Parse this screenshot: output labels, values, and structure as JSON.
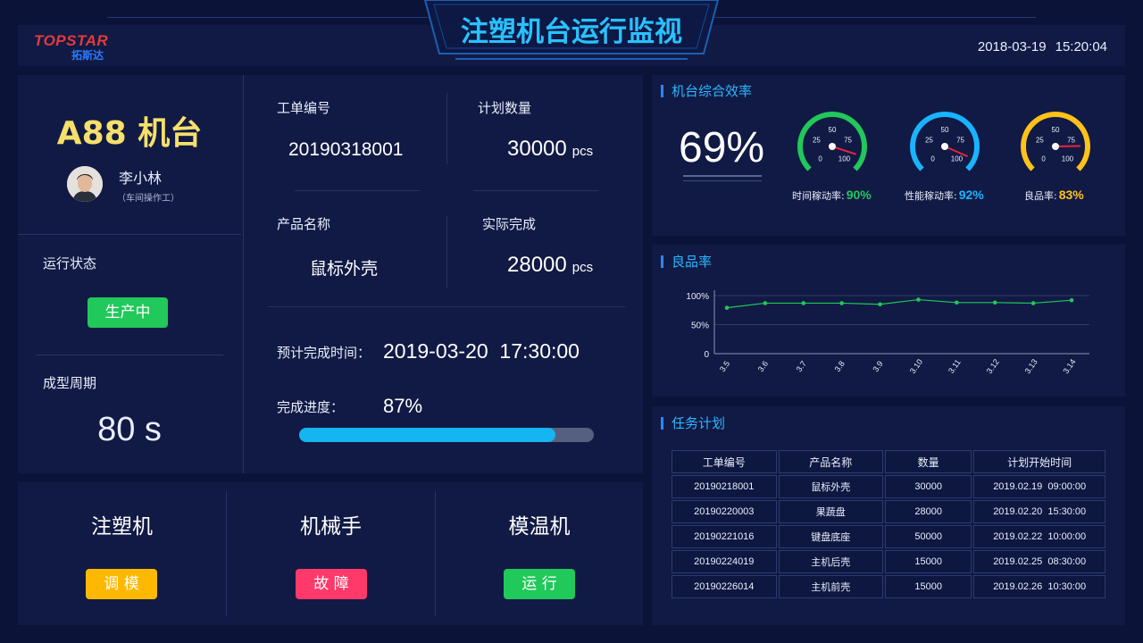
{
  "header": {
    "title": "注塑机台运行监视",
    "logo_en": "TOPSTAR",
    "logo_cn": "拓斯达",
    "date": "2018-03-19",
    "time": "15:20:04"
  },
  "machine": {
    "name": "A88 机台",
    "operator_name": "李小林",
    "operator_role": "（车间操作工）",
    "status_label": "运行状态",
    "status": "生产中",
    "cycle_label": "成型周期",
    "cycle_value": "80 s"
  },
  "order": {
    "order_no_label": "工单编号",
    "order_no": "20190318001",
    "plan_qty_label": "计划数量",
    "plan_qty": "30000",
    "product_label": "产品名称",
    "product": "鼠标外壳",
    "actual_label": "实际完成",
    "actual_qty": "28000",
    "unit": "pcs",
    "eta_label": "预计完成时间：",
    "eta": "2019-03-20  17:30:00",
    "progress_label": "完成进度：",
    "progress_text": "87%",
    "progress_value": 0.87
  },
  "devices": [
    {
      "name": "注塑机",
      "status": "调 模",
      "color": "#ffb800"
    },
    {
      "name": "机械手",
      "status": "故 障",
      "color": "#ff3a6a"
    },
    {
      "name": "模温机",
      "status": "运 行",
      "color": "#21c85a"
    }
  ],
  "efficiency": {
    "title": "机台综合效率",
    "overall": "69%",
    "gauges": [
      {
        "label": "时间稼动率:",
        "value_text": "90%",
        "value": 90,
        "color": "#21c85a"
      },
      {
        "label": "性能稼动率:",
        "value_text": "92%",
        "value": 92,
        "color": "#1ab3ff"
      },
      {
        "label": "良品率:",
        "value_text": "83%",
        "value": 83,
        "color": "#ffc21a"
      }
    ],
    "ticks": [
      "0",
      "25",
      "50",
      "75",
      "100"
    ]
  },
  "chart_data": {
    "type": "line",
    "title": "良品率",
    "categories": [
      "3.5",
      "3.6",
      "3.7",
      "3.8",
      "3.9",
      "3.10",
      "3.11",
      "3.12",
      "3.13",
      "3.14"
    ],
    "series": [
      {
        "values": [
          79,
          87,
          87,
          87,
          85,
          93,
          88,
          88,
          87,
          92
        ]
      }
    ],
    "y_ticks": [
      "100%",
      "50%",
      "0"
    ],
    "ylim": [
      0,
      100
    ],
    "grid": true,
    "color": "#21c85a"
  },
  "tasks": {
    "title": "任务计划",
    "columns": [
      "工单编号",
      "产品名称",
      "数量",
      "计划开始时间"
    ],
    "rows": [
      [
        "20190218001",
        "鼠标外壳",
        "30000",
        "2019.02.19  09:00:00"
      ],
      [
        "20190220003",
        "果蔬盘",
        "28000",
        "2019.02.20  15:30:00"
      ],
      [
        "20190221016",
        "键盘底座",
        "50000",
        "2019.02.22  10:00:00"
      ],
      [
        "20190224019",
        "主机后壳",
        "15000",
        "2019.02.25  08:30:00"
      ],
      [
        "20190226014",
        "主机前壳",
        "15000",
        "2019.02.26  10:30:00"
      ]
    ]
  }
}
